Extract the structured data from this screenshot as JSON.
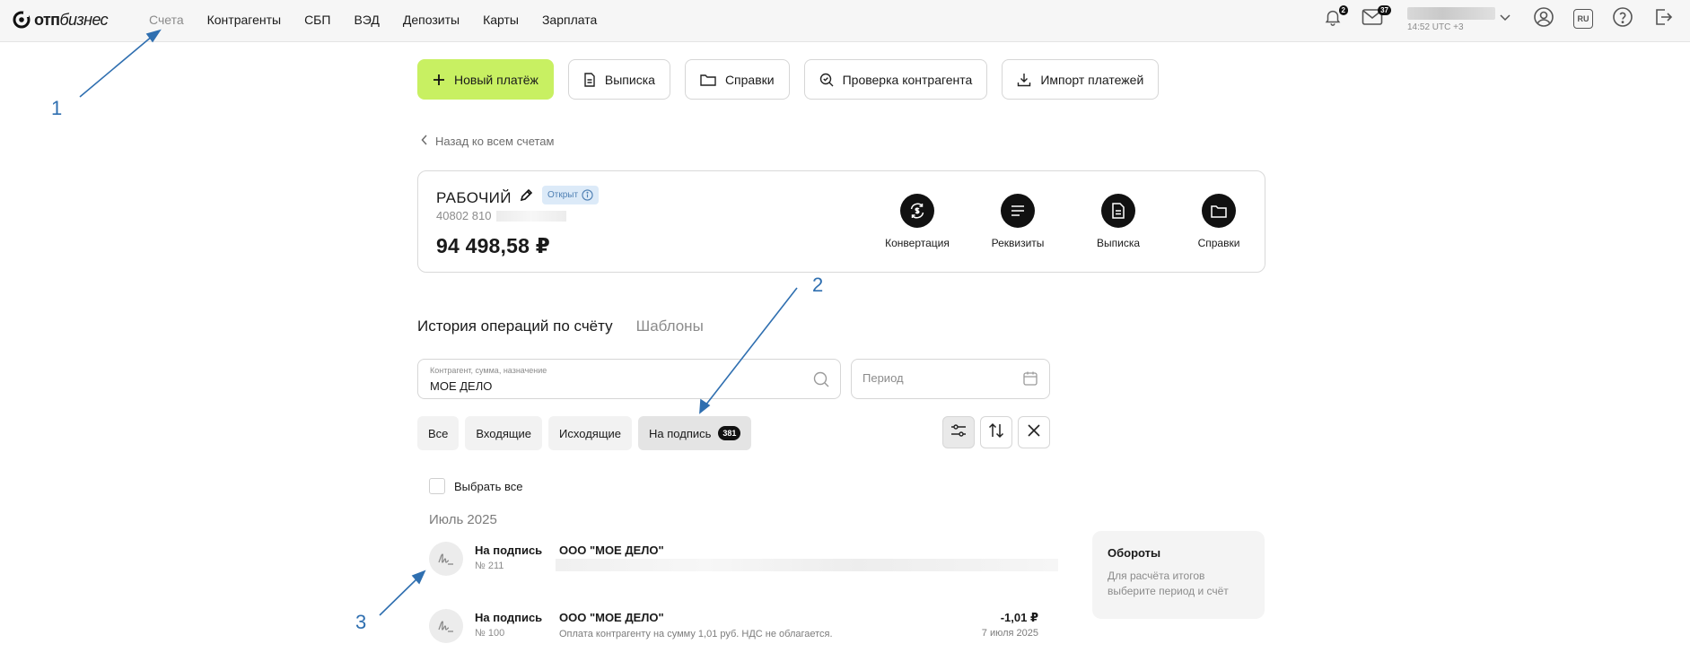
{
  "topbar": {
    "logo_bold": "отп",
    "logo_rest": "бизнес",
    "nav": [
      {
        "label": "Счета",
        "active": false
      },
      {
        "label": "Контрагенты",
        "active": true
      },
      {
        "label": "СБП",
        "active": true
      },
      {
        "label": "ВЭД",
        "active": true
      },
      {
        "label": "Депозиты",
        "active": true
      },
      {
        "label": "Карты",
        "active": true
      },
      {
        "label": "Зарплата",
        "active": true
      }
    ],
    "notifications_count": "2",
    "messages_count": "37",
    "user_time": "14:52 UTC +3",
    "lang": "RU",
    "icons": [
      "bell-icon",
      "mail-icon",
      "chevron-down-icon",
      "profile-icon",
      "language-icon",
      "help-icon",
      "logout-icon"
    ]
  },
  "actions": {
    "new_payment": "Новый платёж",
    "statement": "Выписка",
    "certificates": "Справки",
    "check_counterparty": "Проверка контрагента",
    "import_payments": "Импорт платежей"
  },
  "back_link": "Назад ко всем счетам",
  "account": {
    "name": "РАБОЧИЙ",
    "status": "Открыт",
    "number_prefix": "40802 810",
    "balance": "94 498,58 ₽",
    "tools": {
      "conversion": "Конвертация",
      "requisites": "Реквизиты",
      "statement": "Выписка",
      "certificates": "Справки"
    }
  },
  "history": {
    "tab_history": "История операций по счёту",
    "tab_templates": "Шаблоны",
    "search_label": "Контрагент, сумма, назначение",
    "search_value": "МОЕ ДЕЛО",
    "period_placeholder": "Период",
    "filters": {
      "all": "Все",
      "incoming": "Входящие",
      "outgoing": "Исходящие",
      "to_sign": "На подпись",
      "to_sign_count": "381"
    },
    "select_all": "Выбрать все",
    "month": "Июль 2025",
    "operations": [
      {
        "status": "На подпись",
        "number": "№ 211",
        "counterparty": "ООО \"МОЕ ДЕЛО\"",
        "purpose": "",
        "amount": "",
        "date": ""
      },
      {
        "status": "На подпись",
        "number": "№ 100",
        "counterparty": "ООО \"МОЕ ДЕЛО\"",
        "purpose": "Оплата контрагенту на сумму 1,01 руб. НДС не облагается.",
        "amount": "-1,01 ₽",
        "date": "7 июля 2025"
      }
    ]
  },
  "turnover": {
    "title": "Обороты",
    "text": "Для расчёта итогов выберите период и счёт"
  },
  "annotations": {
    "n1": "1",
    "n2": "2",
    "n3": "3",
    "color": "#2f6fb0"
  },
  "colors": {
    "accent": "#c8f062",
    "status_bg": "#dceaf8",
    "status_text": "#4e7fb3"
  }
}
